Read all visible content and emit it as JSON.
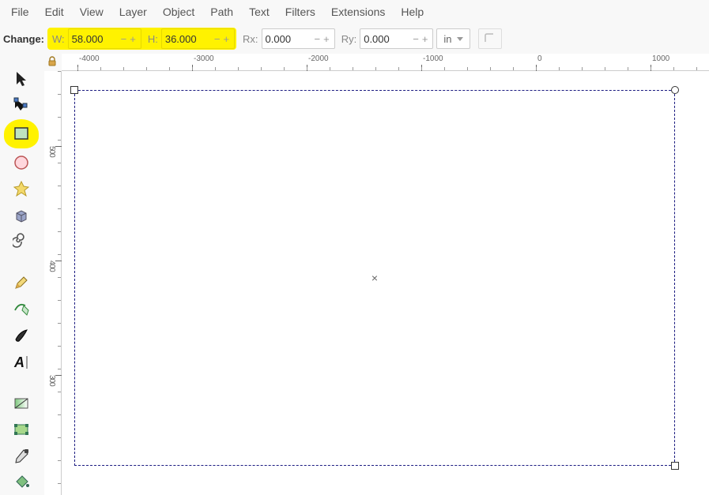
{
  "menu": [
    "File",
    "Edit",
    "View",
    "Layer",
    "Object",
    "Path",
    "Text",
    "Filters",
    "Extensions",
    "Help"
  ],
  "options": {
    "change_label": "Change:",
    "w_label": "W:",
    "w_value": "58.000",
    "h_label": "H:",
    "h_value": "36.000",
    "rx_label": "Rx:",
    "rx_value": "0.000",
    "ry_label": "Ry:",
    "ry_value": "0.000",
    "unit": "in"
  },
  "ruler": {
    "h_ticks": [
      {
        "pos": 20,
        "label": "-4000"
      },
      {
        "pos": 165,
        "label": "-3000"
      },
      {
        "pos": 310,
        "label": "-2000"
      },
      {
        "pos": 455,
        "label": "-1000"
      },
      {
        "pos": 600,
        "label": "0"
      },
      {
        "pos": 745,
        "label": "1000"
      }
    ],
    "v_ticks": [
      {
        "pos": 95,
        "label": "500"
      },
      {
        "pos": 240,
        "label": "400"
      },
      {
        "pos": 385,
        "label": "300"
      }
    ]
  },
  "tools": {
    "selector": "selector",
    "node": "node",
    "rect": "rectangle",
    "ellipse": "ellipse",
    "star": "star",
    "cube": "3d-box",
    "spiral": "spiral",
    "pencil": "pencil",
    "bezier": "bezier",
    "calligraphy": "calligraphy",
    "text": "text",
    "gradient": "gradient",
    "mesh": "mesh",
    "dropper": "dropper",
    "bucket": "paint-bucket"
  }
}
